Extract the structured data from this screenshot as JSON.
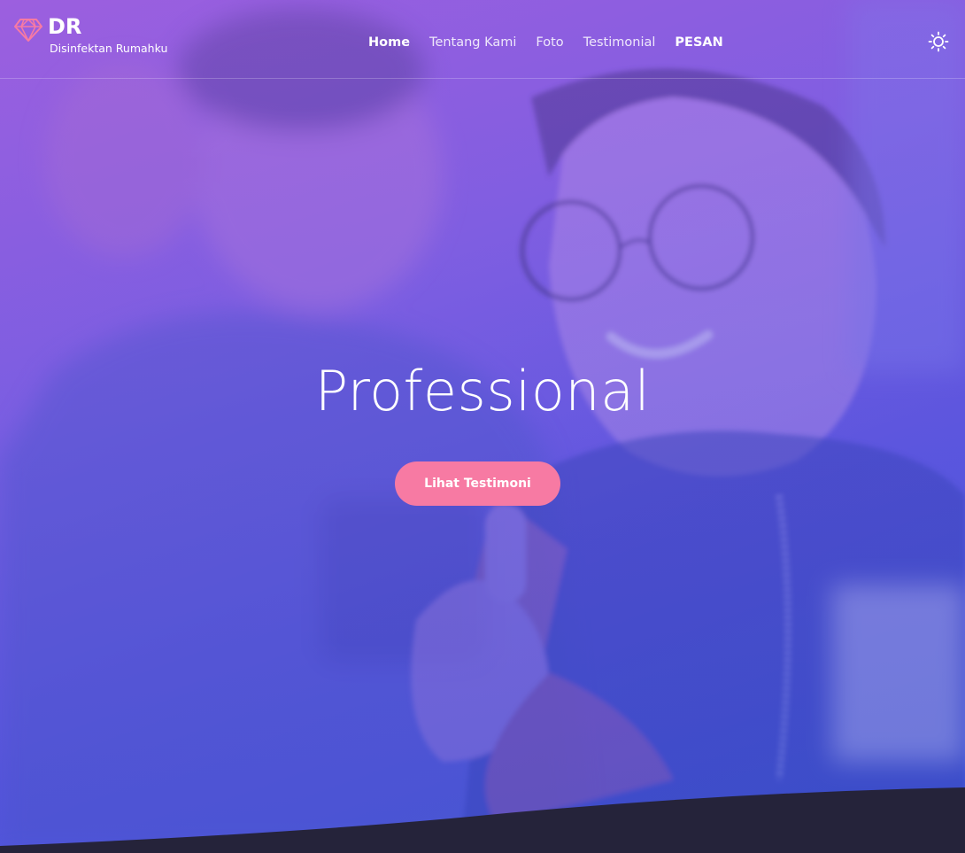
{
  "brand": {
    "title": "DR",
    "subtitle": "Disinfektan Rumahku",
    "icon": "diamond-icon",
    "accent_color": "#f77aa3"
  },
  "nav": {
    "items": [
      {
        "label": "Home"
      },
      {
        "label": "Tentang Kami"
      },
      {
        "label": "Foto"
      },
      {
        "label": "Testimonial"
      },
      {
        "label": "PESAN"
      }
    ],
    "theme_toggle_icon": "sun-icon"
  },
  "hero": {
    "title": "Professional",
    "cta_label": "Lihat Testimoni",
    "gradient_start": "#9a62de",
    "gradient_end": "#3e5bd6"
  },
  "footer_wave_color": "#25233a"
}
